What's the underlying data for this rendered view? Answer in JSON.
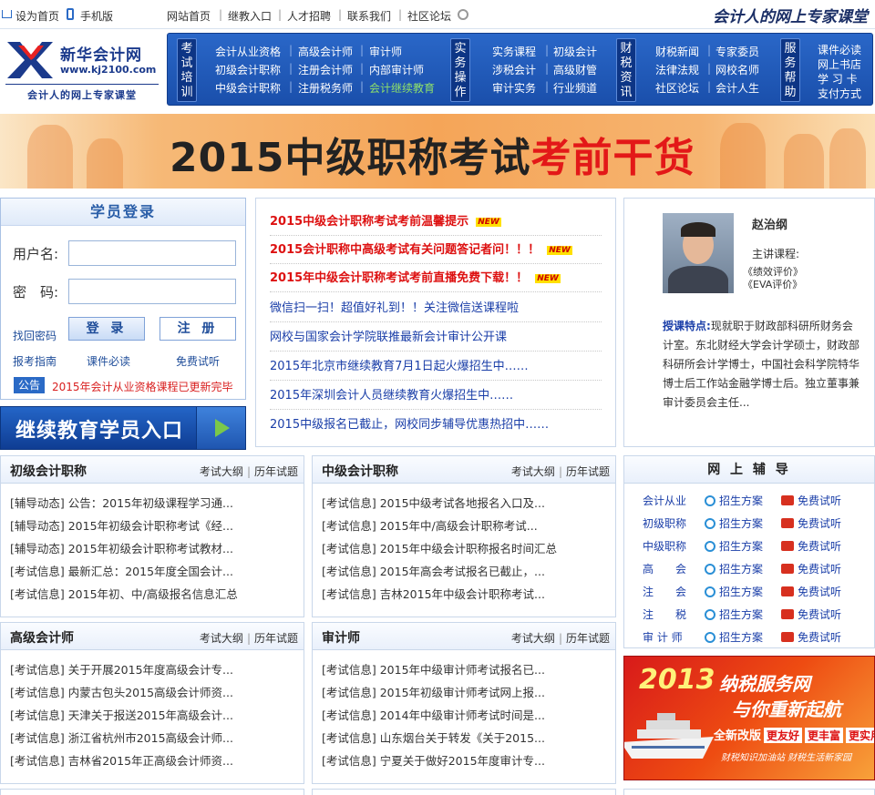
{
  "topbar": {
    "home": "设为首页",
    "mobile": "手机版",
    "links": [
      "网站首页",
      "继教入口",
      "人才招聘",
      "联系我们",
      "社区论坛"
    ],
    "slogan": "会计人的网上专家课堂"
  },
  "logo": {
    "name": "新华会计网",
    "url": "www.kj2100.com",
    "tagline": "会计人的网上专家课堂"
  },
  "nav": {
    "groups": [
      {
        "label": "考试培训",
        "rows": [
          [
            "会计从业资格",
            "高级会计师",
            "审计师"
          ],
          [
            "初级会计职称",
            "注册会计师",
            "内部审计师"
          ],
          [
            "中级会计职称",
            "注册税务师",
            "会计继续教育"
          ]
        ]
      },
      {
        "label": "实务操作",
        "rows": [
          [
            "实务课程",
            "初级会计"
          ],
          [
            "涉税会计",
            "高级财管"
          ],
          [
            "审计实务",
            "行业频道"
          ]
        ]
      },
      {
        "label": "财税资讯",
        "rows": [
          [
            "财税新闻",
            "专家委员"
          ],
          [
            "法律法规",
            "网校名师"
          ],
          [
            "社区论坛",
            "会计人生"
          ]
        ]
      },
      {
        "label": "服务帮助",
        "rows": [
          [
            "课件必读"
          ],
          [
            "网上书店"
          ],
          [
            "学 习 卡"
          ],
          [
            "支付方式"
          ]
        ]
      }
    ]
  },
  "banner": {
    "title": "2015中级职称考试",
    "highlight": "考前干货"
  },
  "login": {
    "title": "学员登录",
    "username_label": "用户名:",
    "password_label": "密　码:",
    "forgot": "找回密码",
    "login_btn": "登 录",
    "register_btn": "注 册",
    "links": [
      "报考指南",
      "课件必读",
      "免费试听"
    ],
    "notice_tag": "公告",
    "notice": "2015年会计从业资格课程已更新完毕"
  },
  "entry": {
    "label": "继续教育学员入口"
  },
  "news": {
    "items": [
      {
        "text": "2015中级会计职称考试考前温馨提示",
        "new": "NEW"
      },
      {
        "text": "2015会计职称中高级考试有关问题答记者问！！！",
        "new": "NEW"
      },
      {
        "text": "2015年中级会计职称考试考前直播免费下载！！",
        "new": "NEW"
      },
      {
        "text": "微信扫一扫！超值好礼到！！关注微信送课程啦"
      },
      {
        "text": "网校与国家会计学院联推最新会计审计公开课"
      },
      {
        "text": "2015年北京市继续教育7月1日起火爆招生中……"
      },
      {
        "text": "2015年深圳会计人员继续教育火爆招生中……"
      },
      {
        "text": "2015中级报名已截止，网校同步辅导优惠热招中……"
      }
    ]
  },
  "teacher": {
    "name": "赵治纲",
    "course_label": "主讲课程:",
    "courses": [
      "《绩效评价》",
      "《EVA评价》"
    ],
    "feature_label": "授课特点:",
    "feature": "现就职于财政部科研所财务会计室。东北财经大学会计学硕士，财政部科研所会计学博士，中国社会科学院特华博士后工作站金融学博士后。独立董事兼审计委员会主任..."
  },
  "columns": [
    {
      "title": "初级会计职称",
      "links": [
        "考试大纲",
        "历年试题"
      ],
      "items": [
        "[辅导动态] 公告：2015年初级课程学习通...",
        "[辅导动态] 2015年初级会计职称考试《经...",
        "[辅导动态] 2015年初级会计职称考试教材...",
        "[考试信息] 最新汇总：2015年度全国会计...",
        "[考试信息] 2015年初、中/高级报名信息汇总"
      ]
    },
    {
      "title": "中级会计职称",
      "links": [
        "考试大纲",
        "历年试题"
      ],
      "items": [
        "[考试信息] 2015中级考试各地报名入口及...",
        "[考试信息] 2015年中/高级会计职称考试...",
        "[考试信息] 2015年中级会计职称报名时间汇总",
        "[考试信息] 2015年高会考试报名已截止，...",
        "[考试信息] 吉林2015年中级会计职称考试..."
      ]
    },
    {
      "title": "高级会计师",
      "links": [
        "考试大纲",
        "历年试题"
      ],
      "items": [
        "[考试信息] 关于开展2015年度高级会计专...",
        "[考试信息] 内蒙古包头2015高级会计师资...",
        "[考试信息] 天津关于报送2015年高级会计...",
        "[考试信息] 浙江省杭州市2015高级会计师...",
        "[考试信息] 吉林省2015年正高级会计师资..."
      ]
    },
    {
      "title": "审计师",
      "links": [
        "考试大纲",
        "历年试题"
      ],
      "items": [
        "[考试信息] 2015年中级审计师考试报名已...",
        "[考试信息] 2015年初级审计师考试网上报...",
        "[考试信息] 2014年中级审计师考试时间是...",
        "[考试信息] 山东烟台关于转发《关于2015...",
        "[考试信息] 宁夏关于做好2015年度审计专..."
      ]
    }
  ],
  "online": {
    "title": "网 上 辅 导",
    "plan": "招生方案",
    "free": "免费试听",
    "categories": [
      "会计从业",
      "初级职称",
      "中级职称",
      "高　　会",
      "注　　会",
      "注　　税",
      "审 计 师"
    ]
  },
  "ad": {
    "year": "2013",
    "t1": "纳税服务网",
    "t2": "与你重新起航",
    "t3": "全新改版",
    "b1": "更友好",
    "b2": "更丰富",
    "b3": "更实用",
    "foot": "财税知识加油站  财税生活新家园"
  }
}
